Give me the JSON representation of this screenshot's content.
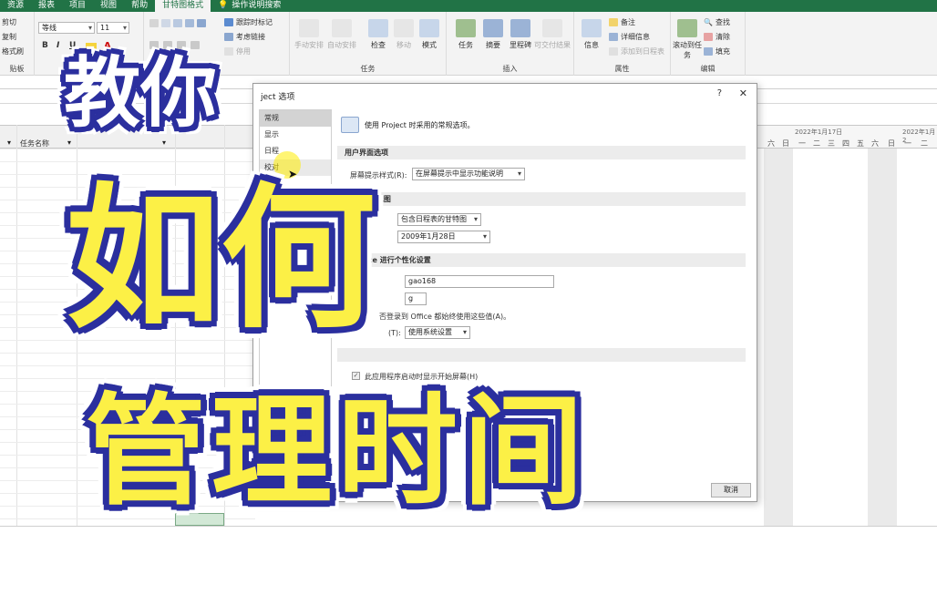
{
  "tabs": [
    "资源",
    "报表",
    "项目",
    "视图",
    "帮助",
    "甘特图格式",
    "操作说明搜索"
  ],
  "active_tab_index": 5,
  "ribbon": {
    "clipboard": {
      "cut": "剪切",
      "copy": "复制",
      "painter": "格式刷",
      "label": "贴板"
    },
    "font": {
      "family": "等线",
      "size": "11"
    },
    "schedule": {
      "mark_track": "跟踪时标记",
      "respect_links": "考虑链接",
      "deactivate": "停用"
    },
    "tasks": {
      "manual": "手动安排",
      "auto": "自动安排",
      "inspect": "检查",
      "move": "移动",
      "mode": "模式",
      "label": "任务"
    },
    "insert": {
      "task": "任务",
      "summary": "摘要",
      "milestone": "里程碑",
      "deliverable": "可交付结果",
      "label": "插入"
    },
    "properties": {
      "info": "信息",
      "notes": "备注",
      "details": "详细信息",
      "add_timeline": "添加到日程表",
      "label": "属性"
    },
    "editing": {
      "scroll": "滚动到任务",
      "find": "查找",
      "clear": "清除",
      "fill": "填充",
      "label": "编辑"
    }
  },
  "grid": {
    "column_task_name": "任务名称"
  },
  "gantt": {
    "dates": [
      "2022年1月17日",
      "2022年1月2"
    ],
    "days": [
      "六",
      "日",
      "一",
      "二",
      "三",
      "四",
      "五",
      "六",
      "日",
      "一",
      "二"
    ]
  },
  "dialog": {
    "title": "ject 选项",
    "help": "?",
    "close": "✕",
    "nav": [
      "常规",
      "显示",
      "日程",
      "校对",
      "保存"
    ],
    "intro": "使用 Project 时采用的常规选项。",
    "sections": {
      "ui": "用户界面选项",
      "view": "Project 视图",
      "personalize": "ft Office 进行个性化设置",
      "start": ""
    },
    "screentip_label": "屏幕提示样式(R):",
    "screentip_value": "在屏幕提示中显示功能说明",
    "default_view": "包含日程表的甘特图",
    "date_format": "2009年1月28日",
    "username": "gao168",
    "initials": "g",
    "always_use": "否登录到 Office 都始终使用这些值(A)。",
    "theme_label": "(T):",
    "theme_value": "使用系统设置",
    "startup_check": "此应用程序启动时显示开始屏幕(H)",
    "cancel": "取消"
  },
  "overlay": {
    "line1": "教你",
    "line2": "如何",
    "line3": "管理时间"
  },
  "colors": {
    "excel_green": "#217346",
    "overlay_yellow": "#fcf046",
    "overlay_outline": "#2b2f9e"
  }
}
